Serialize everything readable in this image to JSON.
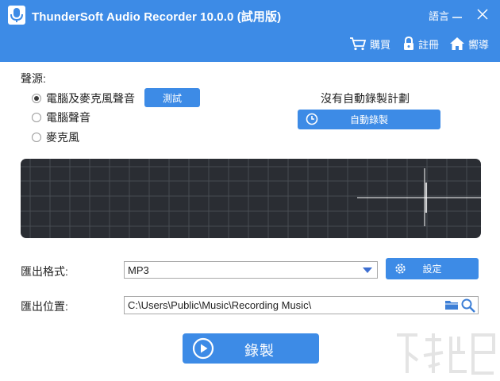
{
  "window": {
    "title": "ThunderSoft Audio Recorder 10.0.0 (試用版)",
    "language_label": "語言",
    "minimize_icon": "minimize-icon",
    "close_icon": "close-icon",
    "app_icon": "microphone-icon"
  },
  "header_actions": [
    {
      "label": "購買",
      "icon": "cart-icon"
    },
    {
      "label": "註冊",
      "icon": "lock-icon"
    },
    {
      "label": "嚮導",
      "icon": "home-icon"
    }
  ],
  "source": {
    "label": "聲源:",
    "options": [
      {
        "label": "電腦及麥克風聲音",
        "checked": true
      },
      {
        "label": "電腦聲音",
        "checked": false
      },
      {
        "label": "麥克風",
        "checked": false
      }
    ],
    "test_button": "測試"
  },
  "schedule": {
    "status_text": "沒有自動錄製計劃",
    "auto_button": "自動錄製",
    "icon": "clock-icon"
  },
  "output": {
    "format_label": "匯出格式:",
    "format_value": "MP3",
    "settings_button": "設定",
    "settings_icon": "gear-icon",
    "location_label": "匯出位置:",
    "location_value": "C:\\Users\\Public\\Music\\Recording Music\\",
    "folder_icon": "folder-icon",
    "search_icon": "search-icon"
  },
  "record": {
    "label": "錄製",
    "icon": "play-circle-icon"
  },
  "colors": {
    "accent": "#3d8be6",
    "visualizer_bg": "#2a2d33",
    "grid": "#4a4e55"
  }
}
